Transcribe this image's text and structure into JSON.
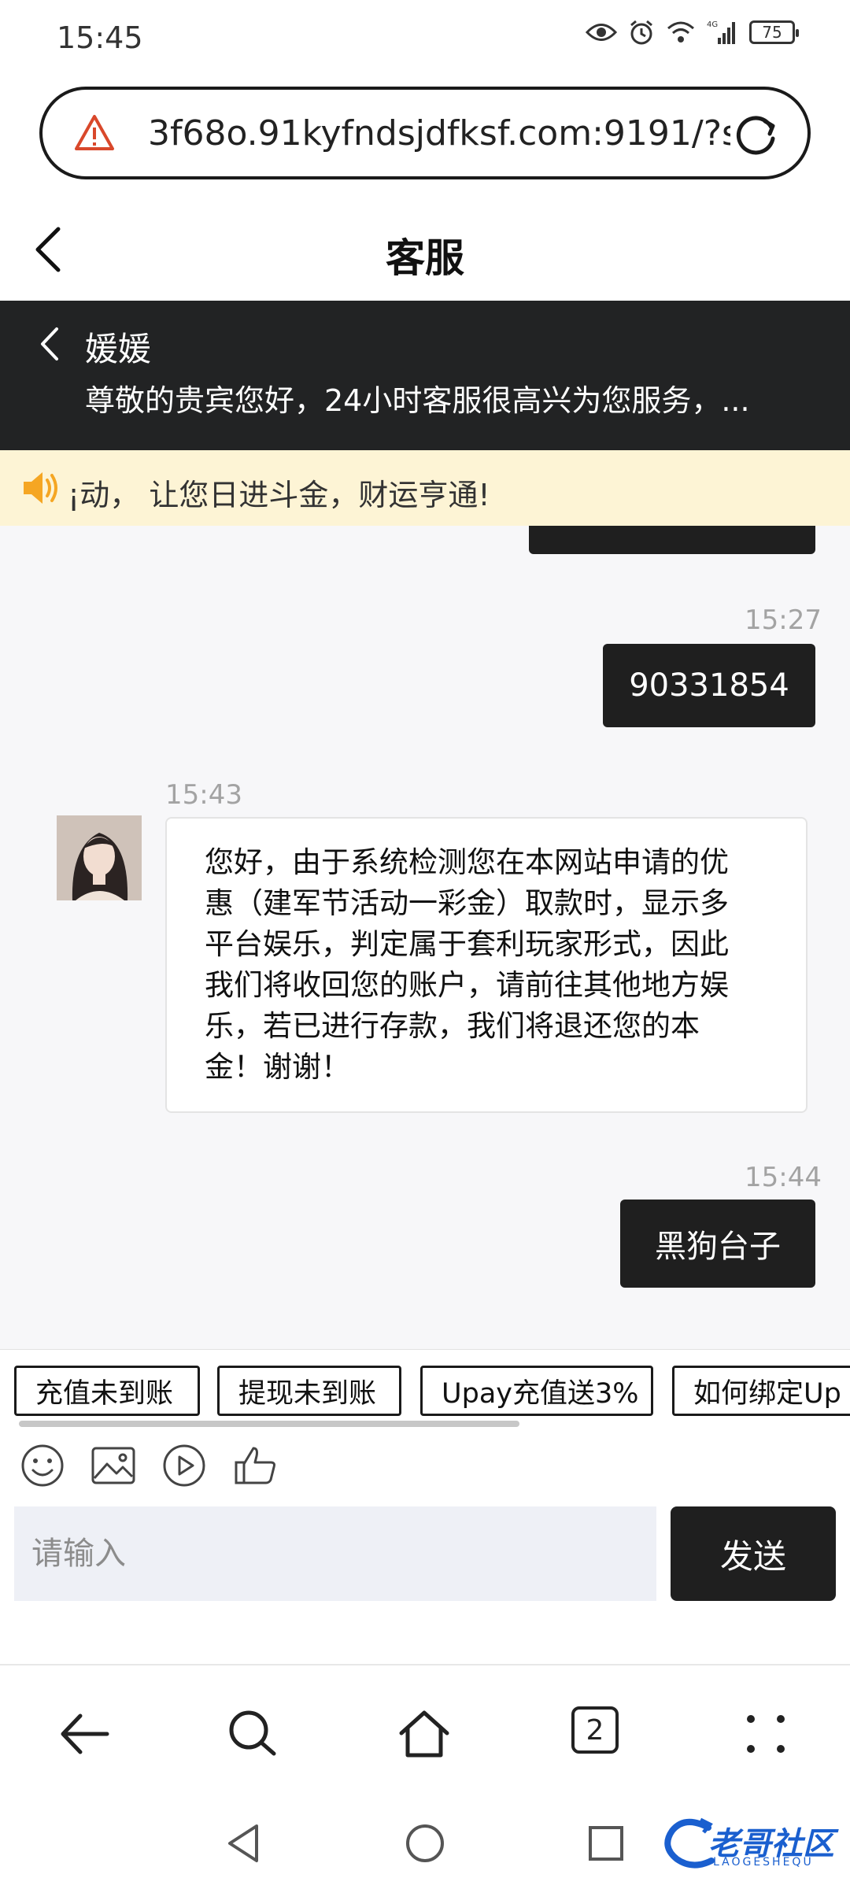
{
  "status_bar": {
    "time": "15:45",
    "battery": "75"
  },
  "browser": {
    "url": "3f68o.91kyfndsjdfksf.com:9191/?s",
    "tab_count": "2"
  },
  "header": {
    "title": "客服"
  },
  "agent": {
    "name": "媛媛",
    "greeting": "尊敬的贵宾您好，24小时客服很高兴为您服务，..."
  },
  "notice": {
    "text": "¡动， 让您日进斗金，财运亨通!"
  },
  "messages": [
    {
      "time": "15:27",
      "text": "90331854"
    },
    {
      "time": "15:43",
      "lines": [
        "您好，由于系统检测您在本网站申请的优",
        "惠（建军节活动一彩金）取款时，显示多",
        "平台娱乐，判定属于套利玩家形式，因此",
        "我们将收回您的账户，请前往其他地方娱",
        "乐，若已进行存款，我们将退还您的本",
        "金！谢谢！"
      ]
    },
    {
      "time": "15:44",
      "text": "黑狗台子"
    }
  ],
  "quick_replies": [
    "充值未到账",
    "提现未到账",
    "Upay充值送3%",
    "如何绑定Up"
  ],
  "input": {
    "placeholder": "请输入",
    "send_label": "发送"
  },
  "watermark": {
    "text": "老哥社区",
    "sub": "LAOGESHEQU"
  },
  "colors": {
    "dark": "#1f1f1f",
    "notice_bg": "#fdf4d5",
    "chat_bg": "#f7f7f9",
    "warning": "#d9482b",
    "speaker": "#f5a623",
    "watermark": "#1a5fcf"
  }
}
